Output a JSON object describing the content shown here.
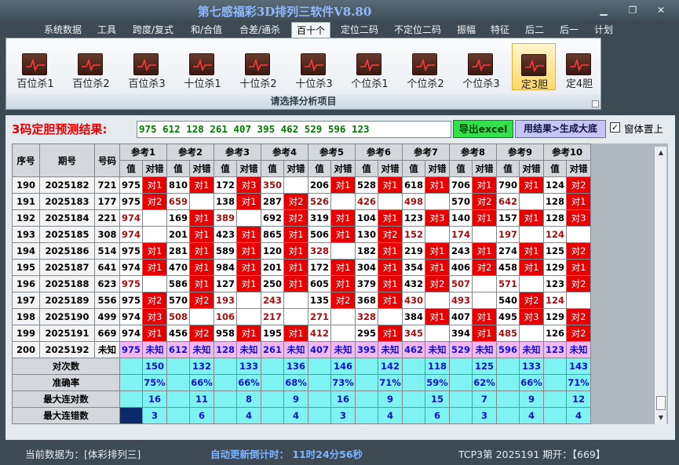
{
  "app": {
    "title": "第七感福彩3D排列三软件V8.80"
  },
  "menu": [
    "系统数据",
    "工具",
    "跨度/复式",
    "和/合值",
    "合差/通杀",
    "百十个",
    "定位二码",
    "不定位二码",
    "振幅",
    "特征",
    "后二",
    "后一",
    "计划"
  ],
  "ribbon": {
    "buttons": [
      "百位杀1",
      "百位杀2",
      "百位杀3",
      "十位杀1",
      "十位杀2",
      "十位杀3",
      "个位杀1",
      "个位杀2",
      "个位杀3",
      "定3胆",
      "定4胆"
    ],
    "active_index": 9,
    "caption": "请选择分析项目"
  },
  "result": {
    "label": "3码定胆预测结果:",
    "value": "975 612 128 261 407 395 462 529 596 123",
    "excel_button": "导出excel",
    "generate_button": "用结果>生成大底",
    "ontop_checked": true,
    "ontop_label": "窗体置上"
  },
  "grid": {
    "columns": {
      "seq": "序号",
      "period": "期号",
      "number": "号码",
      "value": "值",
      "correct": "对错"
    },
    "groups": [
      "参考1",
      "参考2",
      "参考3",
      "参考4",
      "参考5",
      "参考6",
      "参考7",
      "参考8",
      "参考9",
      "参考10"
    ],
    "rows": [
      {
        "seq": "190",
        "period": "2025182",
        "number": "721",
        "cells": [
          [
            "975",
            "对1"
          ],
          [
            "810",
            "对1"
          ],
          [
            "172",
            "对3"
          ],
          [
            "350",
            ""
          ],
          [
            "206",
            "对1"
          ],
          [
            "528",
            "对1"
          ],
          [
            "618",
            "对1"
          ],
          [
            "706",
            "对1"
          ],
          [
            "790",
            "对1"
          ],
          [
            "124",
            "对2"
          ]
        ]
      },
      {
        "seq": "191",
        "period": "2025183",
        "number": "177",
        "cells": [
          [
            "975",
            "对2"
          ],
          [
            "659",
            ""
          ],
          [
            "138",
            "对1"
          ],
          [
            "287",
            "对2"
          ],
          [
            "526",
            ""
          ],
          [
            "426",
            ""
          ],
          [
            "498",
            ""
          ],
          [
            "570",
            "对2"
          ],
          [
            "642",
            ""
          ],
          [
            "128",
            "对1"
          ]
        ]
      },
      {
        "seq": "192",
        "period": "2025184",
        "number": "221",
        "cells": [
          [
            "974",
            ""
          ],
          [
            "169",
            "对1"
          ],
          [
            "389",
            ""
          ],
          [
            "692",
            "对2"
          ],
          [
            "319",
            "对1"
          ],
          [
            "104",
            "对1"
          ],
          [
            "123",
            "对3"
          ],
          [
            "140",
            "对1"
          ],
          [
            "157",
            "对1"
          ],
          [
            "128",
            "对3"
          ]
        ]
      },
      {
        "seq": "193",
        "period": "2025185",
        "number": "308",
        "cells": [
          [
            "974",
            ""
          ],
          [
            "201",
            "对1"
          ],
          [
            "423",
            "对1"
          ],
          [
            "865",
            "对1"
          ],
          [
            "506",
            "对1"
          ],
          [
            "130",
            "对2"
          ],
          [
            "152",
            ""
          ],
          [
            "174",
            ""
          ],
          [
            "197",
            ""
          ],
          [
            "124",
            ""
          ]
        ]
      },
      {
        "seq": "194",
        "period": "2025186",
        "number": "514",
        "cells": [
          [
            "975",
            "对1"
          ],
          [
            "281",
            "对1"
          ],
          [
            "589",
            "对1"
          ],
          [
            "120",
            "对1"
          ],
          [
            "328",
            ""
          ],
          [
            "182",
            "对1"
          ],
          [
            "219",
            "对1"
          ],
          [
            "243",
            "对1"
          ],
          [
            "274",
            "对1"
          ],
          [
            "125",
            "对2"
          ]
        ]
      },
      {
        "seq": "195",
        "period": "2025187",
        "number": "641",
        "cells": [
          [
            "974",
            "对1"
          ],
          [
            "470",
            "对1"
          ],
          [
            "984",
            "对1"
          ],
          [
            "201",
            "对1"
          ],
          [
            "172",
            "对1"
          ],
          [
            "304",
            "对1"
          ],
          [
            "354",
            "对1"
          ],
          [
            "406",
            "对2"
          ],
          [
            "458",
            "对1"
          ],
          [
            "129",
            "对1"
          ]
        ]
      },
      {
        "seq": "196",
        "period": "2025188",
        "number": "623",
        "cells": [
          [
            "975",
            ""
          ],
          [
            "586",
            "对1"
          ],
          [
            "127",
            "对1"
          ],
          [
            "250",
            "对1"
          ],
          [
            "605",
            "对1"
          ],
          [
            "379",
            "对1"
          ],
          [
            "432",
            "对2"
          ],
          [
            "507",
            ""
          ],
          [
            "571",
            ""
          ],
          [
            "123",
            "对2"
          ]
        ]
      },
      {
        "seq": "197",
        "period": "2025189",
        "number": "556",
        "cells": [
          [
            "975",
            "对2"
          ],
          [
            "570",
            "对2"
          ],
          [
            "193",
            ""
          ],
          [
            "243",
            ""
          ],
          [
            "135",
            "对2"
          ],
          [
            "368",
            "对1"
          ],
          [
            "430",
            ""
          ],
          [
            "493",
            ""
          ],
          [
            "540",
            "对2"
          ],
          [
            "124",
            ""
          ]
        ]
      },
      {
        "seq": "198",
        "period": "2025190",
        "number": "499",
        "cells": [
          [
            "974",
            "对3"
          ],
          [
            "508",
            ""
          ],
          [
            "106",
            ""
          ],
          [
            "217",
            ""
          ],
          [
            "271",
            ""
          ],
          [
            "328",
            ""
          ],
          [
            "384",
            "对1"
          ],
          [
            "407",
            "对1"
          ],
          [
            "495",
            "对3"
          ],
          [
            "129",
            "对2"
          ]
        ]
      },
      {
        "seq": "199",
        "period": "2025191",
        "number": "669",
        "cells": [
          [
            "974",
            "对1"
          ],
          [
            "456",
            "对2"
          ],
          [
            "958",
            "对1"
          ],
          [
            "195",
            "对1"
          ],
          [
            "412",
            ""
          ],
          [
            "295",
            "对1"
          ],
          [
            "345",
            ""
          ],
          [
            "394",
            "对1"
          ],
          [
            "485",
            ""
          ],
          [
            "126",
            "对2"
          ]
        ]
      }
    ],
    "pending_row": {
      "seq": "200",
      "period": "2025192",
      "number": "未知",
      "values": [
        "975",
        "612",
        "128",
        "261",
        "407",
        "395",
        "462",
        "529",
        "596",
        "123"
      ],
      "status": "未知"
    },
    "stats": [
      {
        "label": "对次数",
        "values": [
          "150",
          "132",
          "133",
          "136",
          "146",
          "142",
          "118",
          "125",
          "133",
          "143"
        ]
      },
      {
        "label": "准确率",
        "values": [
          "75%",
          "66%",
          "66%",
          "68%",
          "73%",
          "71%",
          "59%",
          "62%",
          "66%",
          "71%"
        ]
      },
      {
        "label": "最大连对数",
        "values": [
          "16",
          "11",
          "8",
          "9",
          "16",
          "9",
          "15",
          "7",
          "9",
          "12"
        ]
      },
      {
        "label": "最大连错数",
        "values": [
          "3",
          "6",
          "4",
          "4",
          "3",
          "4",
          "6",
          "3",
          "4",
          "4"
        ]
      }
    ]
  },
  "status": {
    "current_data": "当前数据为：[体彩排列三]",
    "countdown": "自动更新倒计时： 11时24分56秒",
    "period_info": "TCP3第 2025191 期开：【669】"
  },
  "colors": {
    "hit_cell": "#e80000",
    "stat_row": "#7ff2f2",
    "pending_row": "#f2b8f2",
    "excel_button": "#33e24b"
  }
}
